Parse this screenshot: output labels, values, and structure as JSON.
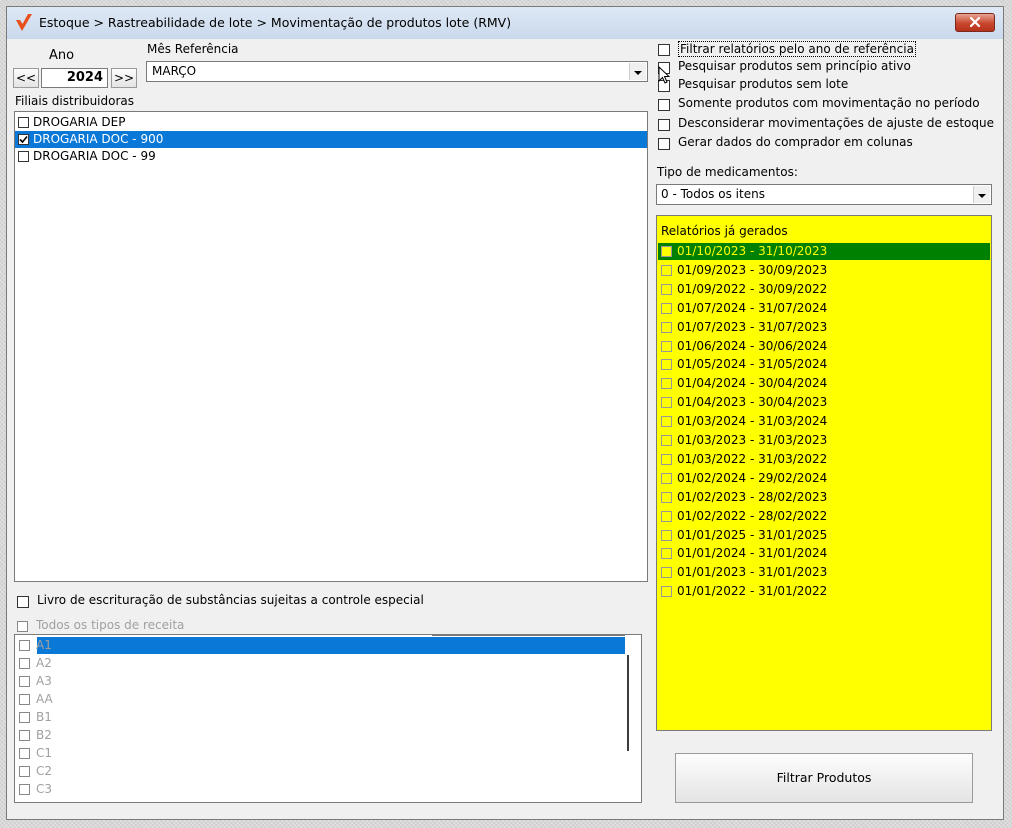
{
  "window": {
    "title": "Estoque > Rastreabilidade de lote > Movimentação de produtos lote (RMV)",
    "close_label": "x"
  },
  "year": {
    "label": "Ano",
    "value": "2024",
    "prev_label": "<<",
    "next_label": ">>"
  },
  "month": {
    "label": "Mês Referência",
    "value": "MARÇO"
  },
  "branches": {
    "label": "Filiais distribuidoras",
    "items": [
      {
        "label": "DROGARIA DEP",
        "checked": false,
        "selected": false
      },
      {
        "label": "DROGARIA DOC - 900",
        "checked": true,
        "selected": true
      },
      {
        "label": "DROGARIA DOC - 99",
        "checked": false,
        "selected": false
      }
    ]
  },
  "livro": {
    "label": "Livro de escrituração de substâncias sujeitas a controle especial"
  },
  "receitas": {
    "all_label": "Todos os tipos de receita",
    "items": [
      "A1",
      "A2",
      "A3",
      "AA",
      "B1",
      "B2",
      "C1",
      "C2",
      "C3"
    ]
  },
  "options": [
    "Filtrar relatórios pelo ano de referência",
    "Pesquisar produtos sem princípio ativo",
    "Pesquisar produtos sem lote",
    "Somente produtos com movimentação no período",
    "Desconsiderar movimentações de ajuste de estoque",
    "Gerar dados do comprador em colunas"
  ],
  "medicamentos": {
    "label": "Tipo de medicamentos:",
    "value": "0 - Todos os itens"
  },
  "reports": {
    "label": "Relatórios já gerados",
    "items": [
      "01/10/2023 - 31/10/2023",
      "01/09/2023 - 30/09/2023",
      "01/09/2022 - 30/09/2022",
      "01/07/2024 - 31/07/2024",
      "01/07/2023 - 31/07/2023",
      "01/06/2024 - 30/06/2024",
      "01/05/2024 - 31/05/2024",
      "01/04/2024 - 30/04/2024",
      "01/04/2023 - 30/04/2023",
      "01/03/2024 - 31/03/2024",
      "01/03/2023 - 31/03/2023",
      "01/03/2022 - 31/03/2022",
      "01/02/2024 - 29/02/2024",
      "01/02/2023 - 28/02/2023",
      "01/02/2022 - 28/02/2022",
      "01/01/2025 - 31/01/2025",
      "01/01/2024 - 31/01/2024",
      "01/01/2023 - 31/01/2023",
      "01/01/2022 - 31/01/2022"
    ],
    "background_color": "#ffff00",
    "selected_color": "#008000"
  },
  "filter_button": {
    "label": "Filtrar Produtos"
  },
  "colors": {
    "selection": "#0a78d7"
  }
}
